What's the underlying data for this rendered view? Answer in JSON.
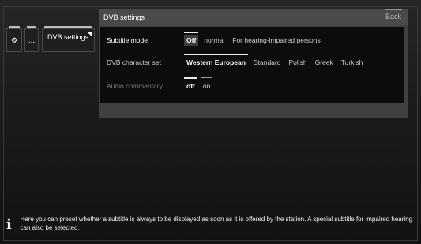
{
  "left_nav": {
    "dots_label": "...",
    "dvb_label": "DVB settings"
  },
  "panel": {
    "title": "DVB settings",
    "back_label": "Back",
    "rows": [
      {
        "label": "Subtitle mode",
        "options": [
          "Off",
          "normal",
          "For hearing-impaired persons"
        ],
        "selected": "Off"
      },
      {
        "label": "DVB character set",
        "options": [
          "Western European",
          "Standard",
          "Polish",
          "Greek",
          "Turkish"
        ],
        "selected": "Western European"
      },
      {
        "label": "Audio commentary",
        "options": [
          "off",
          "on"
        ],
        "selected": "off"
      }
    ]
  },
  "info": {
    "text": "Here you can preset whether a subtitle is always to be displayed as soon as it is offered by the station. A special subtitle for impaired hearing can also be selected."
  }
}
